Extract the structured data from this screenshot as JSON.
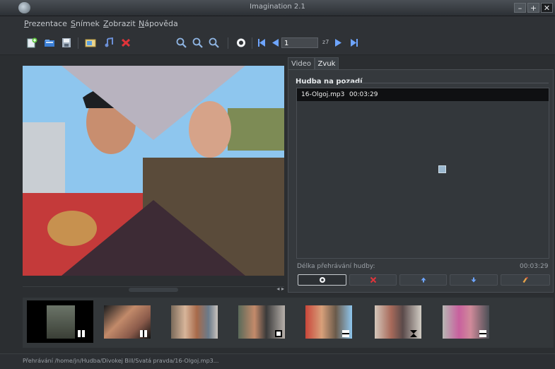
{
  "window": {
    "title": "Imagination 2.1",
    "buttons": [
      "–",
      "+",
      "✕"
    ]
  },
  "menu": {
    "items": [
      {
        "key": "P",
        "rest": "rezentace"
      },
      {
        "key": "S",
        "rest": "nímek"
      },
      {
        "key": "Z",
        "rest": "obrazit"
      },
      {
        "key": "N",
        "rest": "ápověda"
      }
    ]
  },
  "toolbar": {
    "icons": [
      "new-slideshow-icon",
      "open-icon",
      "save-icon",
      "import-pictures-icon",
      "import-music-icon",
      "delete-icon",
      "zoom-in-icon",
      "zoom-out-icon",
      "zoom-fit-icon",
      "preview-icon",
      "first-slide-icon",
      "previous-slide-icon",
      "next-slide-icon",
      "last-slide-icon"
    ],
    "slide_number": "1",
    "slide_total": "z7"
  },
  "tabs": [
    {
      "label": "Video",
      "active": false
    },
    {
      "label": "Zvuk",
      "active": true
    }
  ],
  "audio": {
    "section_title": "Hudba na pozadí",
    "playlist": [
      {
        "file": "16-Olgoj.mp3",
        "duration": "00:03:29"
      }
    ],
    "duration_label": "Délka přehrávání hudby:",
    "duration_value": "00:03:29",
    "buttons": [
      "play-icon",
      "remove-icon",
      "move-up-icon",
      "move-down-icon",
      "clear-icon"
    ]
  },
  "thumbnails": [
    {
      "name": "slide-1",
      "selected": true,
      "transition": "checker"
    },
    {
      "name": "slide-2",
      "selected": false,
      "transition": "checker"
    },
    {
      "name": "slide-3",
      "selected": false,
      "transition": "none"
    },
    {
      "name": "slide-4",
      "selected": false,
      "transition": "cube"
    },
    {
      "name": "slide-5",
      "selected": false,
      "transition": "bar"
    },
    {
      "name": "slide-6",
      "selected": false,
      "transition": "hourglass"
    },
    {
      "name": "slide-7",
      "selected": false,
      "transition": "bar"
    }
  ],
  "status": {
    "text": "Přehrávání /home/jn/Hudba/Divokej Bill/Svatá pravda/16-Olgoj.mp3..."
  },
  "colors": {
    "accent": "#6ea5ff",
    "delete": "#e0343a",
    "selection": "#000000"
  }
}
